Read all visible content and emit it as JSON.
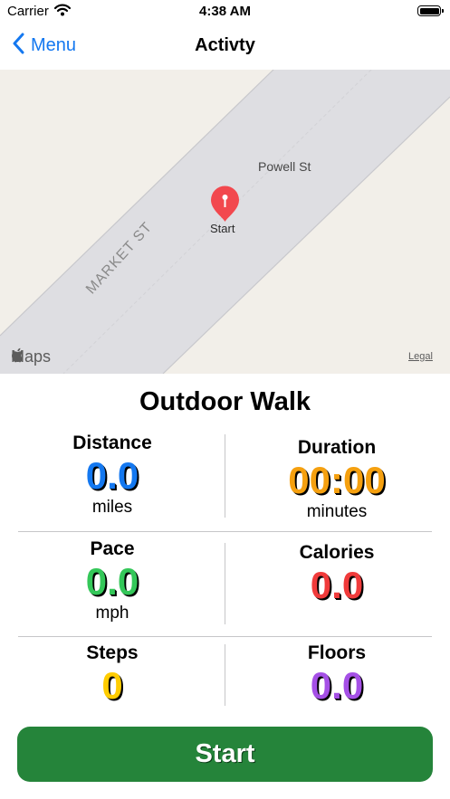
{
  "status_bar": {
    "carrier": "Carrier",
    "time": "4:38 AM"
  },
  "nav": {
    "back_label": "Menu",
    "title": "Activty"
  },
  "map": {
    "street_1": "Powell St",
    "street_2": "MARKET ST",
    "pin_label": "Start",
    "attribution": "Maps",
    "legal": "Legal"
  },
  "activity": {
    "title": "Outdoor Walk",
    "distance": {
      "label": "Distance",
      "value": "0.0",
      "unit": "miles",
      "color": "#1478f0"
    },
    "duration": {
      "label": "Duration",
      "value": "00:00",
      "unit": "minutes",
      "color": "#f5a00f"
    },
    "pace": {
      "label": "Pace",
      "value": "0.0",
      "unit": "mph",
      "color": "#34c759"
    },
    "calories": {
      "label": "Calories",
      "value": "0.0",
      "color": "#f03b3b"
    },
    "steps": {
      "label": "Steps",
      "value": "0",
      "color": "#ffcc00"
    },
    "floors": {
      "label": "Floors",
      "value": "0.0",
      "color": "#a550e6"
    }
  },
  "start_button": {
    "label": "Start",
    "color": "#25843a"
  },
  "icons": [
    "wifi-icon",
    "battery-icon",
    "chevron-left-icon",
    "map-pin-icon",
    "apple-logo-icon"
  ]
}
